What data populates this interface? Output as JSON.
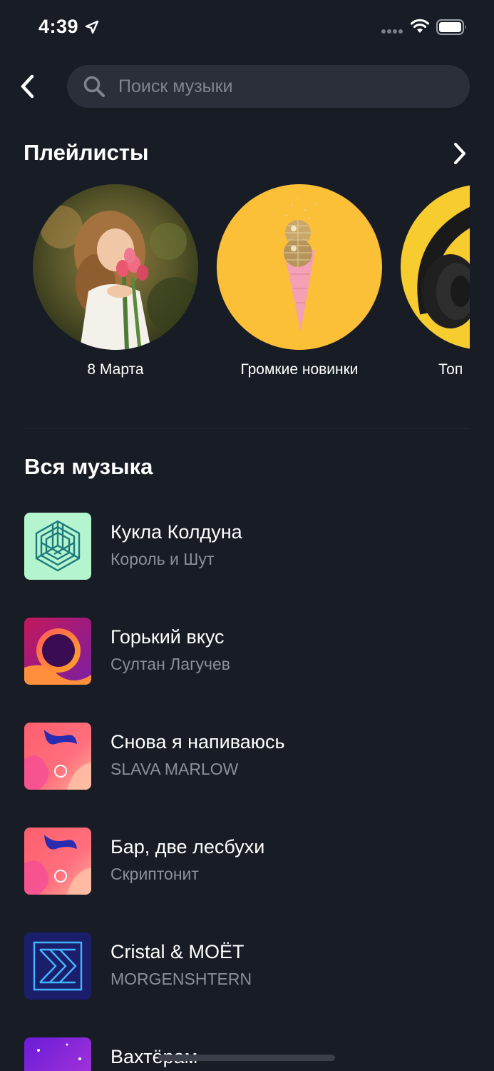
{
  "status_bar": {
    "time": "4:39"
  },
  "search": {
    "placeholder": "Поиск музыки"
  },
  "playlists": {
    "title": "Плейлисты",
    "items": [
      {
        "name": "8 Марта",
        "icon": "girl-with-tulips-image"
      },
      {
        "name": "Громкие новинки",
        "icon": "disco-ice-cream-image"
      },
      {
        "name": "Топ",
        "icon": "headphones-image"
      }
    ]
  },
  "all_music": {
    "title": "Вся музыка",
    "tracks": [
      {
        "title": "Кукла Колдуна",
        "artist": "Король и Шут",
        "art": "hexagon-cube-art"
      },
      {
        "title": "Горький вкус",
        "artist": "Султан Лагучев",
        "art": "ring-art"
      },
      {
        "title": "Снова я напиваюсь",
        "artist": "SLAVA MARLOW",
        "art": "coral-wave-art"
      },
      {
        "title": "Бар, две лесбухи",
        "artist": "Скриптонит",
        "art": "coral-wave-art"
      },
      {
        "title": "Cristal & МОЁТ",
        "artist": "MORGENSHTERN",
        "art": "arrows-art"
      },
      {
        "title": "Вахтёрам",
        "artist": "",
        "art": "purple-stars-art"
      }
    ]
  },
  "colors": {
    "background": "#181c25",
    "search_bg": "#2a2f39",
    "secondary_text": "#8a8f99"
  }
}
